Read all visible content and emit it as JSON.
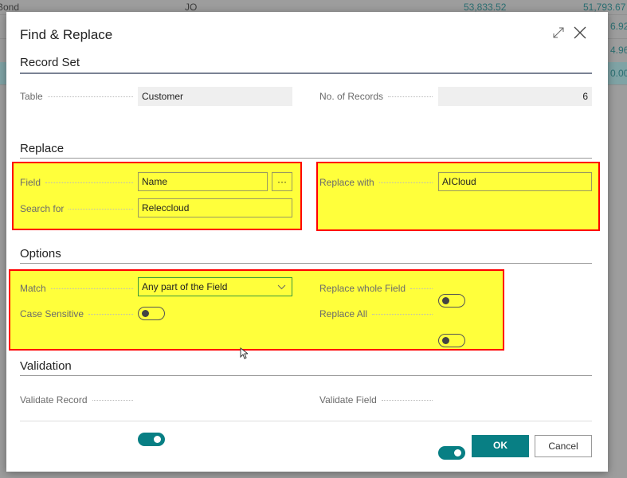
{
  "background": {
    "rows": [
      {
        "name": "Bond",
        "code": "JO",
        "v1": "53,833.52",
        "v2": "51,793.67"
      },
      {
        "name": "",
        "code": "",
        "v1": "",
        "v2": "6.92"
      },
      {
        "name": "",
        "code": "",
        "v1": "",
        "v2": "4.96"
      },
      {
        "name": "",
        "code": "",
        "v1": "",
        "v2": "0.00"
      }
    ]
  },
  "dialog": {
    "title": "Find & Replace",
    "record_set": {
      "heading": "Record Set",
      "table_label": "Table",
      "table_value": "Customer",
      "records_label": "No. of Records",
      "records_value": "6"
    },
    "replace": {
      "heading": "Replace",
      "field_label": "Field",
      "field_value": "Name",
      "lookup_label": "···",
      "search_label": "Search for",
      "search_value": "Releccloud",
      "replace_with_label": "Replace with",
      "replace_with_value": "AICloud"
    },
    "options": {
      "heading": "Options",
      "match_label": "Match",
      "match_value": "Any part of the Field",
      "case_label": "Case Sensitive",
      "case_on": false,
      "whole_label": "Replace whole Field",
      "whole_on": false,
      "all_label": "Replace All",
      "all_on": false
    },
    "validation": {
      "heading": "Validation",
      "record_label": "Validate Record",
      "record_on": true,
      "field_label": "Validate Field",
      "field_on": true
    },
    "ok": "OK",
    "cancel": "Cancel"
  },
  "colors": {
    "accent": "#087f84",
    "highlight": "#ffff3b",
    "highlight_border": "#ff0000"
  }
}
